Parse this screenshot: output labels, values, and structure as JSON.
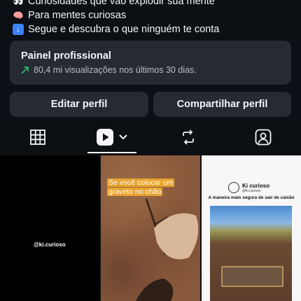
{
  "bio": {
    "lines": [
      {
        "icon": "eyes-emoji",
        "text": "Curiosidades que vão explodir sua mente"
      },
      {
        "icon": "brain-emoji",
        "text": "Para mentes curiosas"
      },
      {
        "icon": "down-arrow-emoji",
        "text": "Segue e descubra o que ninguém te conta"
      }
    ]
  },
  "professional_panel": {
    "title": "Painel profissional",
    "views": "80,4 mi visualizações nos últimos 30 dias."
  },
  "buttons": {
    "edit": "Editar perfil",
    "share": "Compartilhar perfil"
  },
  "tabs": [
    {
      "icon": "grid-icon",
      "selected": false
    },
    {
      "icon": "reels-play-icon",
      "selected": true
    },
    {
      "icon": "repost-icon",
      "selected": false
    },
    {
      "icon": "tagged-person-icon",
      "selected": false
    }
  ],
  "posts": [
    {
      "handle": "@ki.curioso"
    },
    {
      "caption_line1": "Se você colocar um",
      "caption_line2": "graveto no chão"
    },
    {
      "brand": "Ki curioso",
      "brand_handle": "@ki.curioso",
      "headline": "A maneira mais segura de sair de caixão"
    }
  ],
  "colors": {
    "background": "#0c0f14",
    "card": "#262a31",
    "trend_green": "#2fbf71",
    "caption_highlight": "#e7a32d"
  }
}
